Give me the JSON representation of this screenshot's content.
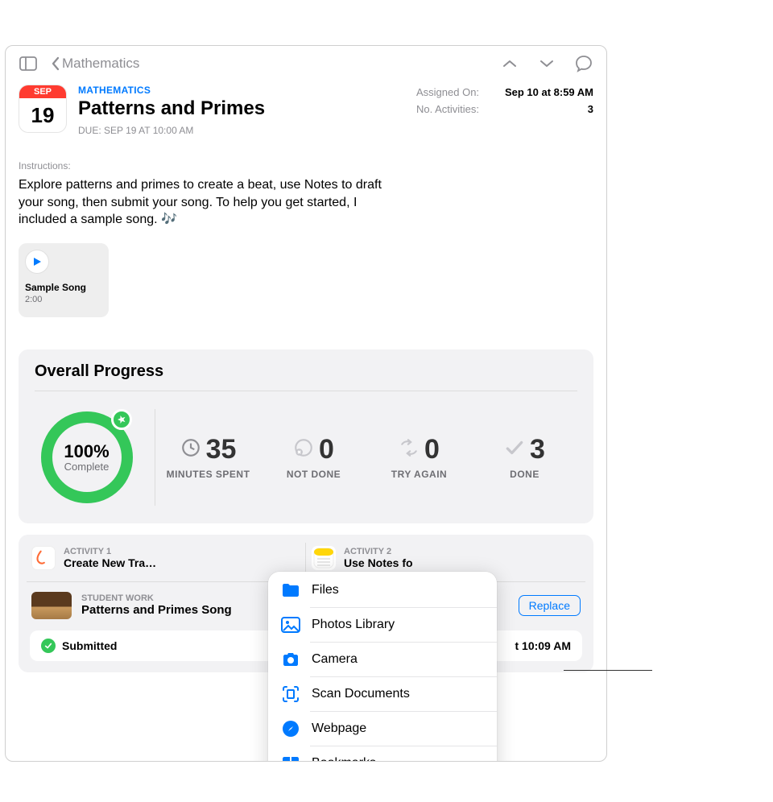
{
  "nav": {
    "back_label": "Mathematics"
  },
  "header": {
    "subject": "MATHEMATICS",
    "title": "Patterns and Primes",
    "due_label": "DUE: SEP 19 AT 10:00 AM",
    "cal_month": "SEP",
    "cal_day": "19"
  },
  "meta": {
    "assigned_key": "Assigned On:",
    "assigned_val": "Sep 10 at 8:59 AM",
    "activities_key": "No. Activities:",
    "activities_val": "3"
  },
  "instructions": {
    "label": "Instructions:",
    "body": "Explore patterns and primes to create a beat, use Notes to draft your song, then submit your song. To help you get started, I included a sample song. 🎶"
  },
  "attachment": {
    "title": "Sample Song",
    "duration": "2:00"
  },
  "progress": {
    "card_title": "Overall Progress",
    "percent_value": "100%",
    "percent_label": "Complete",
    "percent_number": 100,
    "stats": [
      {
        "value": "35",
        "label": "MINUTES SPENT",
        "icon": "clock"
      },
      {
        "value": "0",
        "label": "NOT DONE",
        "icon": "xcircle"
      },
      {
        "value": "0",
        "label": "TRY AGAIN",
        "icon": "retry"
      },
      {
        "value": "3",
        "label": "DONE",
        "icon": "check"
      }
    ]
  },
  "activities": {
    "items": [
      {
        "kicker": "ACTIVITY 1",
        "title": "Create New Tra…",
        "icon": "guitar",
        "bg": "#fff"
      },
      {
        "kicker": "ACTIVITY 2",
        "title": "Use Notes fo",
        "icon": "notes",
        "bg": "#ffd60a"
      }
    ]
  },
  "student_work": {
    "kicker": "STUDENT WORK",
    "title": "Patterns and Primes Song",
    "replace_label": "Replace"
  },
  "submitted": {
    "label": "Submitted",
    "time_suffix": "t 10:09 AM"
  },
  "popover": [
    {
      "label": "Files",
      "icon": "folder"
    },
    {
      "label": "Photos Library",
      "icon": "photo"
    },
    {
      "label": "Camera",
      "icon": "camera"
    },
    {
      "label": "Scan Documents",
      "icon": "scan"
    },
    {
      "label": "Webpage",
      "icon": "safari"
    },
    {
      "label": "Bookmarks",
      "icon": "bookmark"
    }
  ],
  "colors": {
    "accent": "#007aff",
    "success": "#34c759",
    "red": "#ff3b30",
    "gray": "#8e8e93"
  }
}
